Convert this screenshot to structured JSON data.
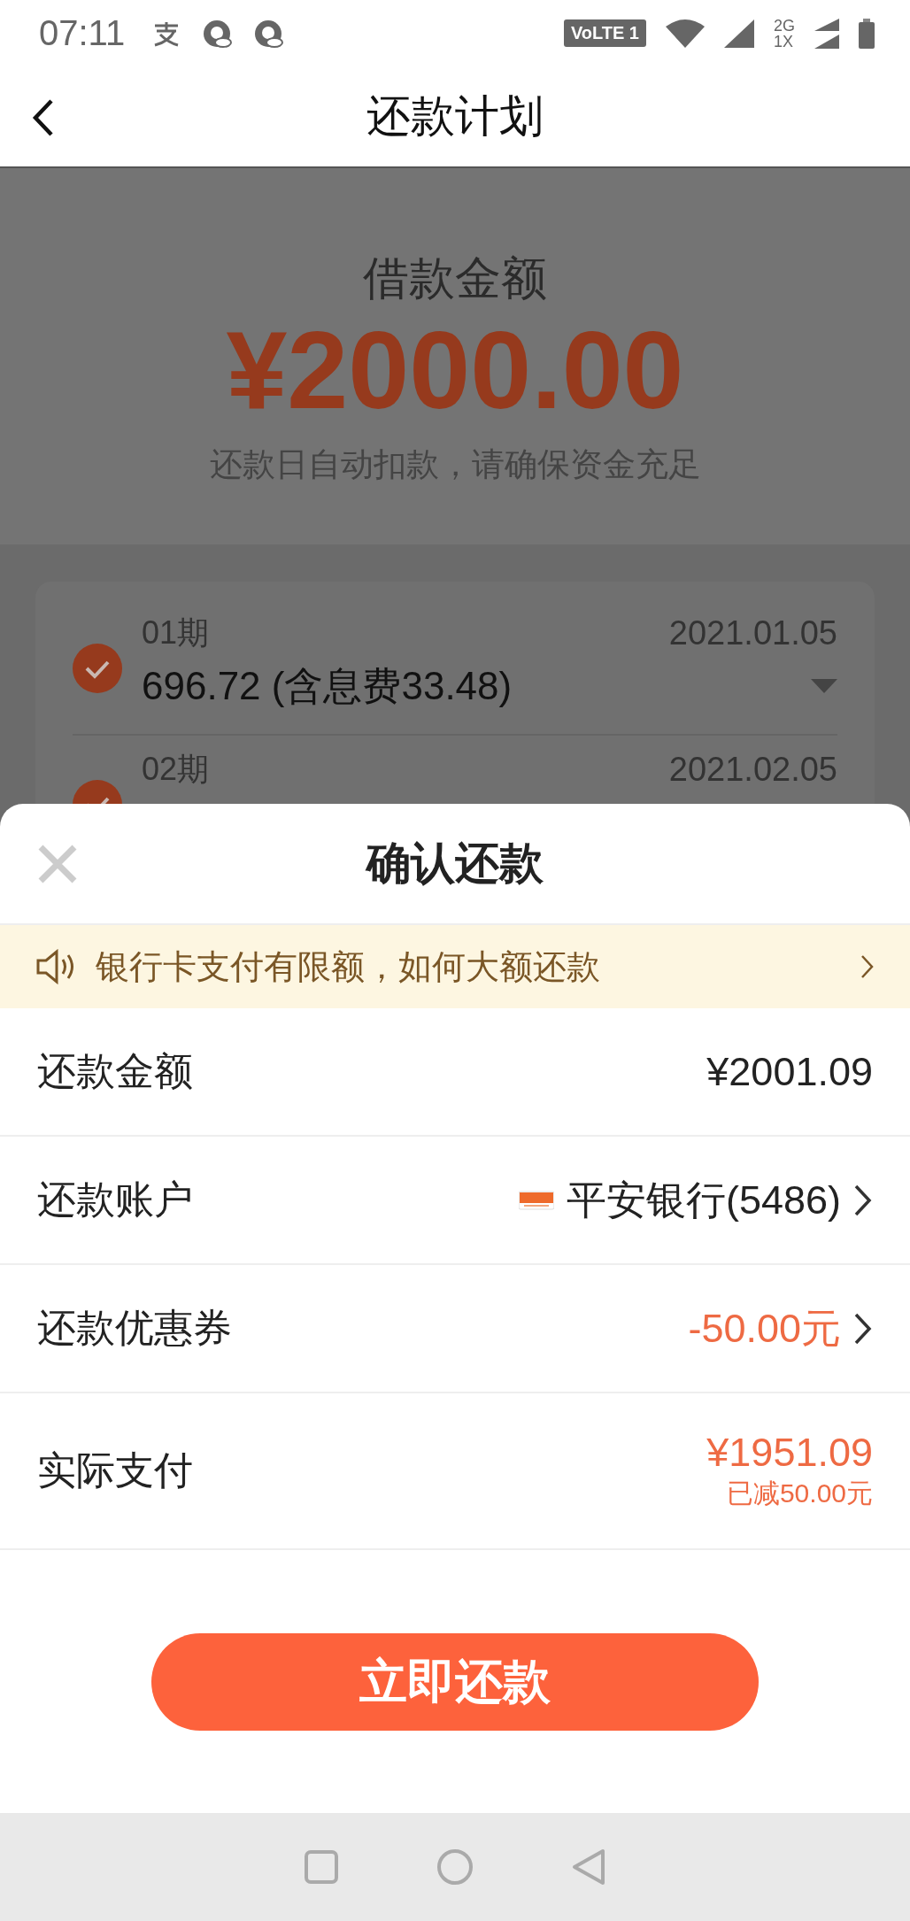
{
  "status_bar": {
    "time": "07:11",
    "network_badge": "VoLTE 1",
    "network_types": [
      "2G",
      "1X"
    ]
  },
  "nav": {
    "title": "还款计划"
  },
  "loan": {
    "label": "借款金额",
    "amount": "¥2000.00",
    "note": "还款日自动扣款，请确保资金充足"
  },
  "installments": [
    {
      "period": "01期",
      "date": "2021.01.05",
      "amount": "696.72 (含息费33.48)",
      "checked": true,
      "expanded": false
    },
    {
      "period": "02期",
      "date": "2021.02.05",
      "checked": true
    }
  ],
  "sheet": {
    "title": "确认还款",
    "notice": "银行卡支付有限额，如何大额还款",
    "rows": [
      {
        "kind": "plain",
        "label": "还款金额",
        "value": "¥2001.09"
      },
      {
        "kind": "bank",
        "label": "还款账户",
        "value": "平安银行(5486)"
      },
      {
        "kind": "coupon",
        "label": "还款优惠券",
        "value": "-50.00元"
      },
      {
        "kind": "total",
        "label": "实际支付",
        "value": "¥1951.09",
        "note": "已减50.00元"
      }
    ],
    "button": "立即还款"
  }
}
